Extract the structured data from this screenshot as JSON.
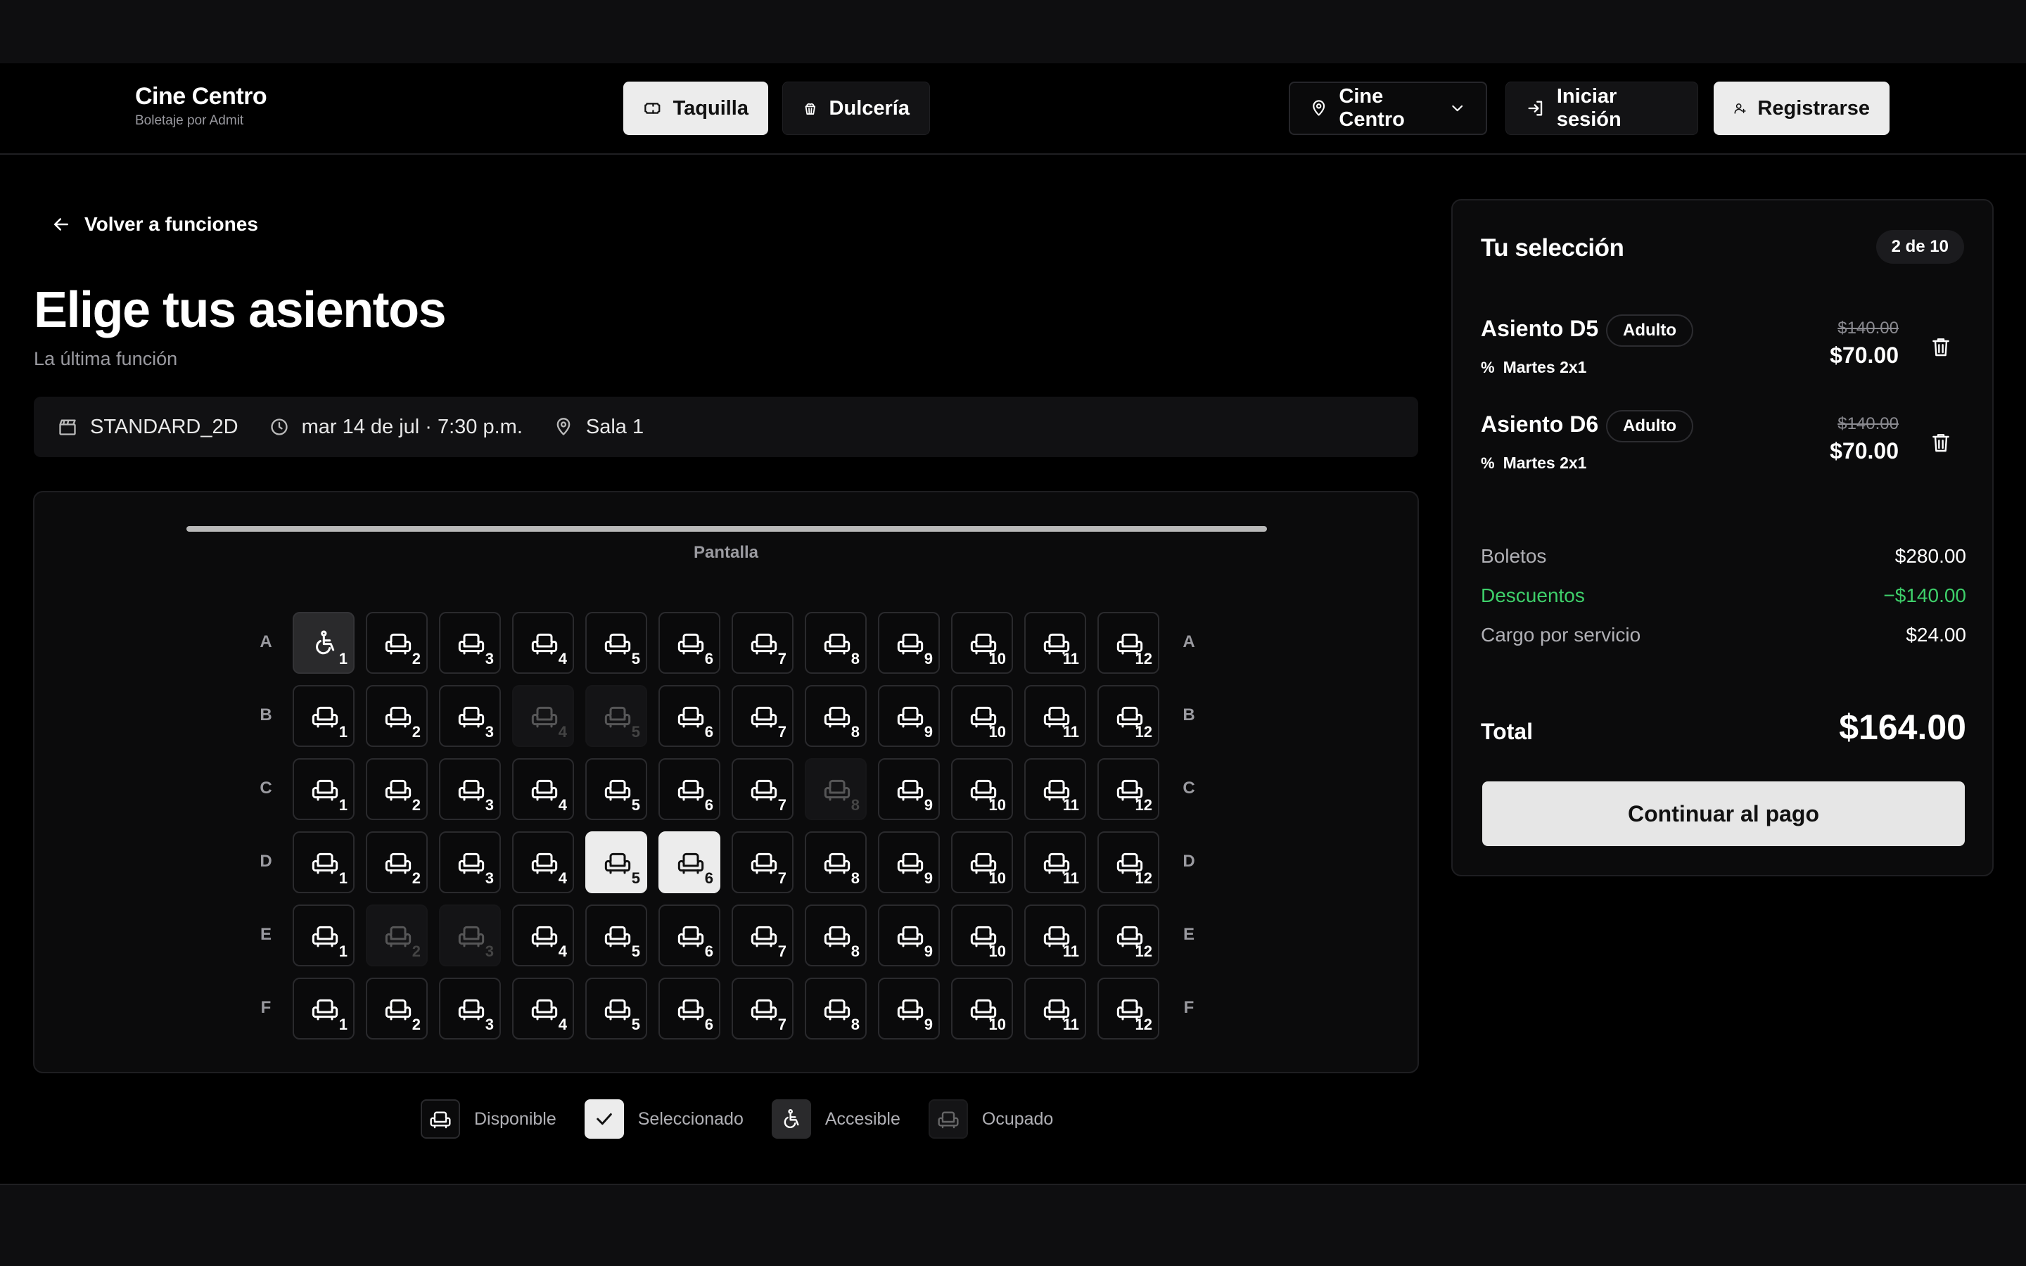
{
  "brand": {
    "title": "Cine Centro",
    "subtitle": "Boletaje por Admit"
  },
  "nav": {
    "taquilla": "Taquilla",
    "dulceria": "Dulcería",
    "location": "Cine Centro",
    "login": "Iniciar sesión",
    "register": "Registrarse"
  },
  "main": {
    "back": "Volver a funciones",
    "title": "Elige tus asientos",
    "subtitle": "La última función",
    "format": "STANDARD_2D",
    "datetime": "mar 14 de jul · 7:30 p.m.",
    "room": "Sala 1",
    "screen_label": "Pantalla"
  },
  "seatmap": {
    "rows": [
      "A",
      "B",
      "C",
      "D",
      "E",
      "F"
    ],
    "seats_per_row": 12,
    "accessible": [
      "A1"
    ],
    "occupied": [
      "B4",
      "B5",
      "C8",
      "E2",
      "E3"
    ],
    "selected": [
      "D5",
      "D6"
    ]
  },
  "legend": {
    "available": "Disponible",
    "selected": "Seleccionado",
    "accessible": "Accesible",
    "occupied": "Ocupado"
  },
  "summary": {
    "title": "Tu selección",
    "count": "2 de 10",
    "tickets": [
      {
        "seat": "Asiento D5",
        "type": "Adulto",
        "promo": "Martes 2x1",
        "old_price": "$140.00",
        "price": "$70.00"
      },
      {
        "seat": "Asiento D6",
        "type": "Adulto",
        "promo": "Martes 2x1",
        "old_price": "$140.00",
        "price": "$70.00"
      }
    ],
    "boletos_label": "Boletos",
    "boletos_value": "$280.00",
    "descuentos_label": "Descuentos",
    "descuentos_value": "−$140.00",
    "cargo_label": "Cargo por servicio",
    "cargo_value": "$24.00",
    "total_label": "Total",
    "total_value": "$164.00",
    "pay_button": "Continuar al pago"
  },
  "colors": {
    "accent_light": "#ececec",
    "discount": "#3ecf6a",
    "background": "#000000"
  }
}
